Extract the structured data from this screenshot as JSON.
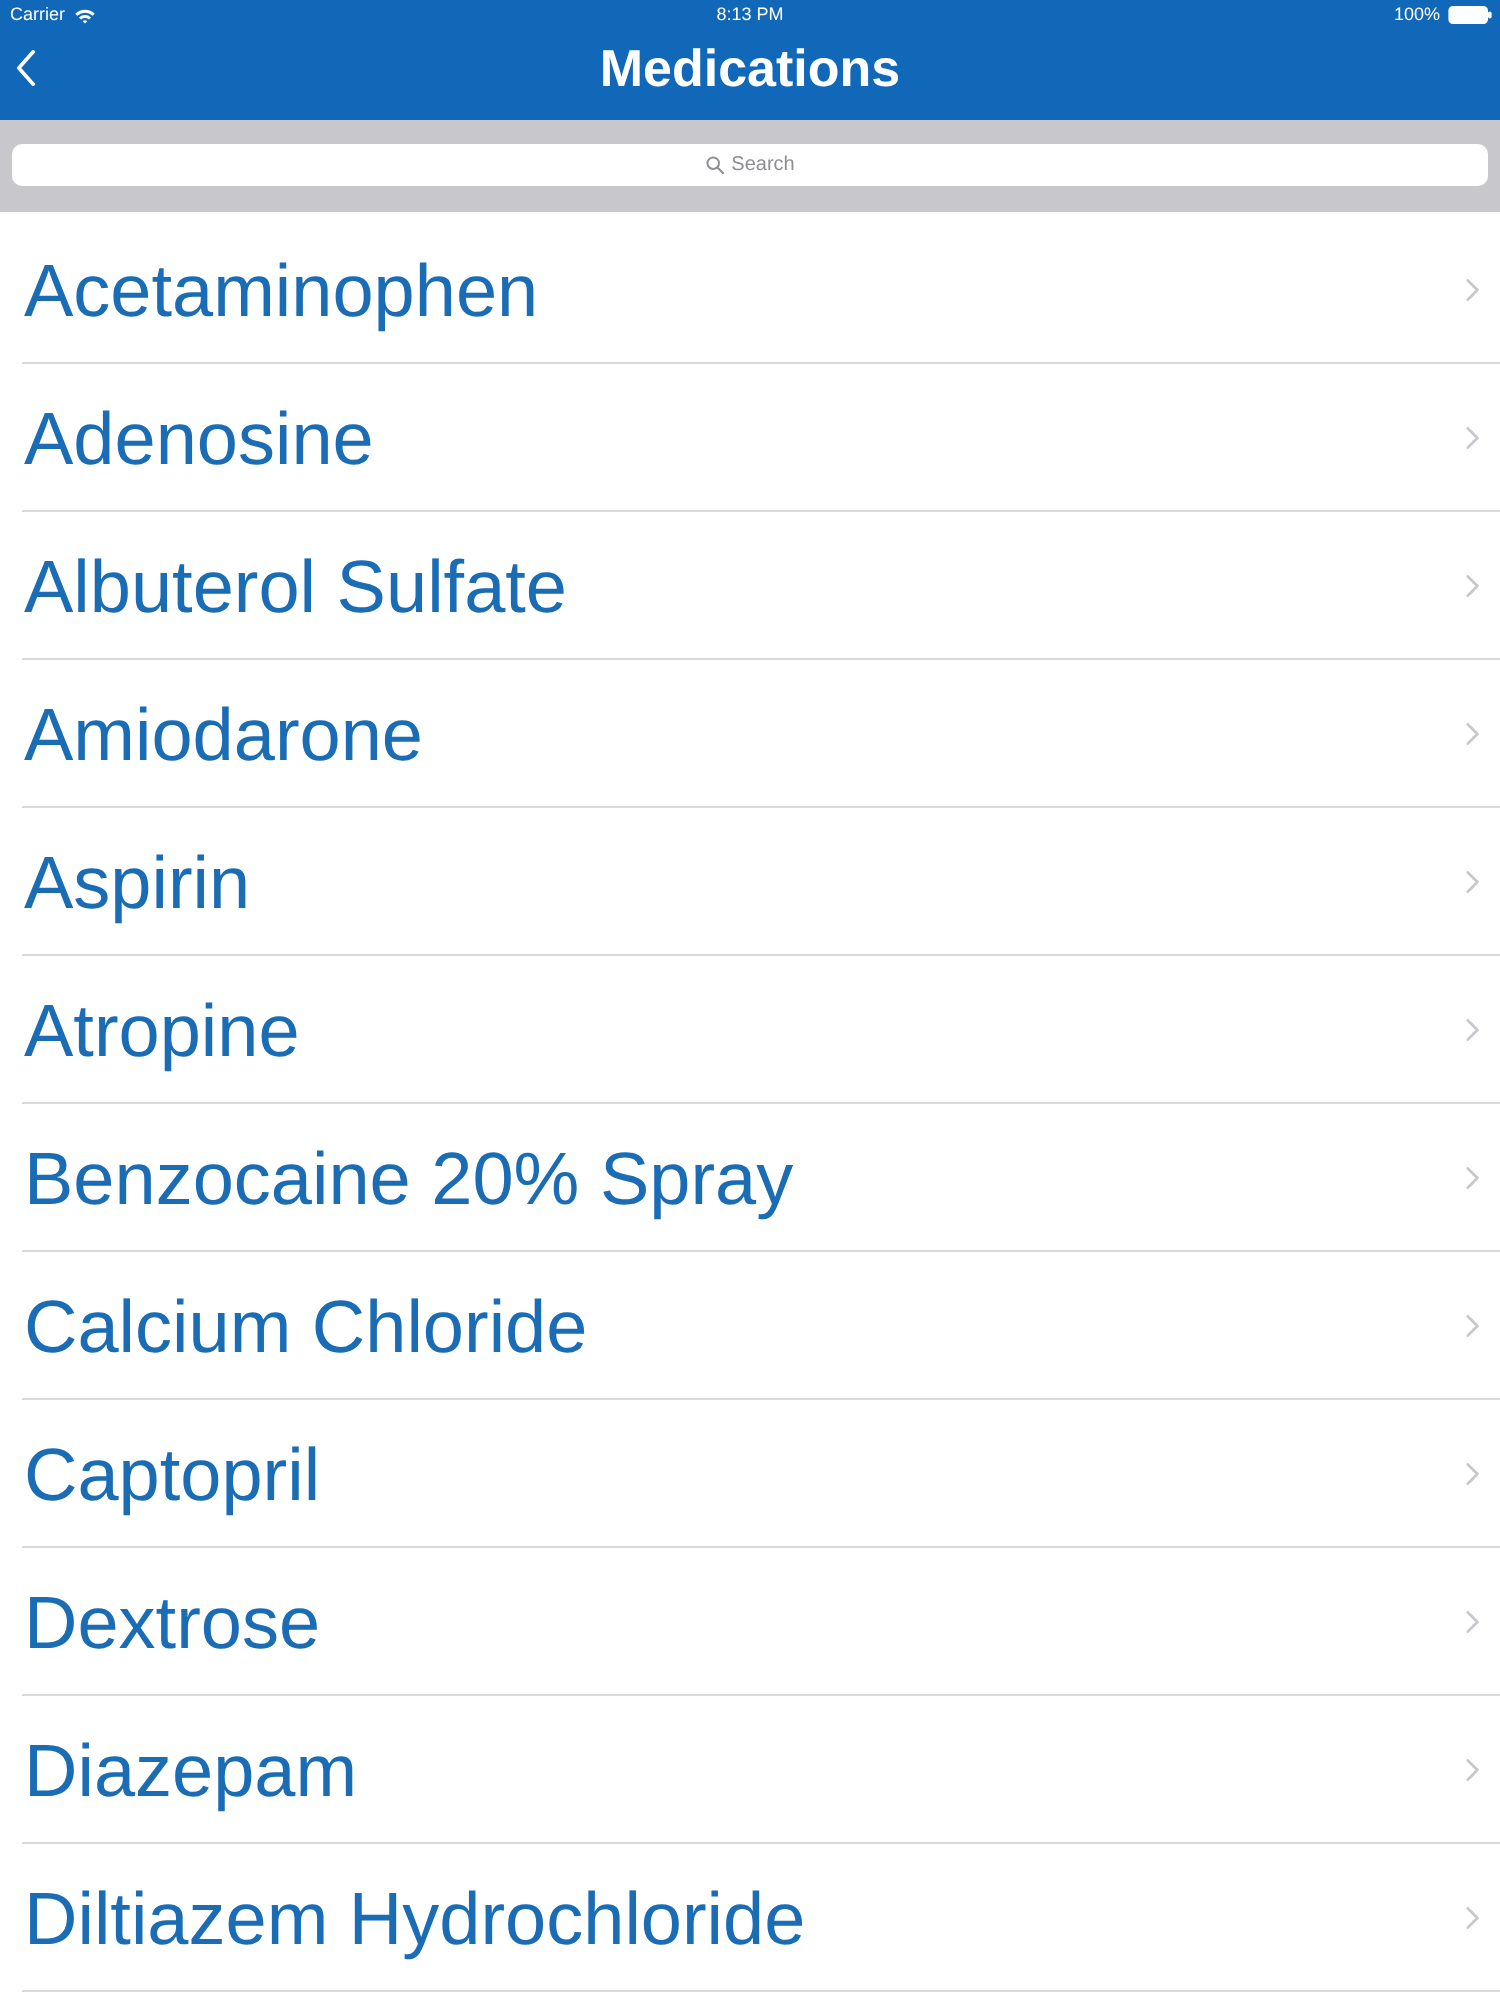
{
  "status_bar": {
    "carrier": "Carrier",
    "time": "8:13 PM",
    "battery": "100%"
  },
  "nav_bar": {
    "title": "Medications"
  },
  "search": {
    "placeholder": "Search"
  },
  "medications": [
    {
      "name": "Acetaminophen"
    },
    {
      "name": "Adenosine"
    },
    {
      "name": "Albuterol Sulfate"
    },
    {
      "name": "Amiodarone"
    },
    {
      "name": "Aspirin"
    },
    {
      "name": "Atropine"
    },
    {
      "name": "Benzocaine 20% Spray"
    },
    {
      "name": "Calcium Chloride"
    },
    {
      "name": "Captopril"
    },
    {
      "name": "Dextrose"
    },
    {
      "name": "Diazepam"
    },
    {
      "name": "Diltiazem Hydrochloride"
    }
  ]
}
